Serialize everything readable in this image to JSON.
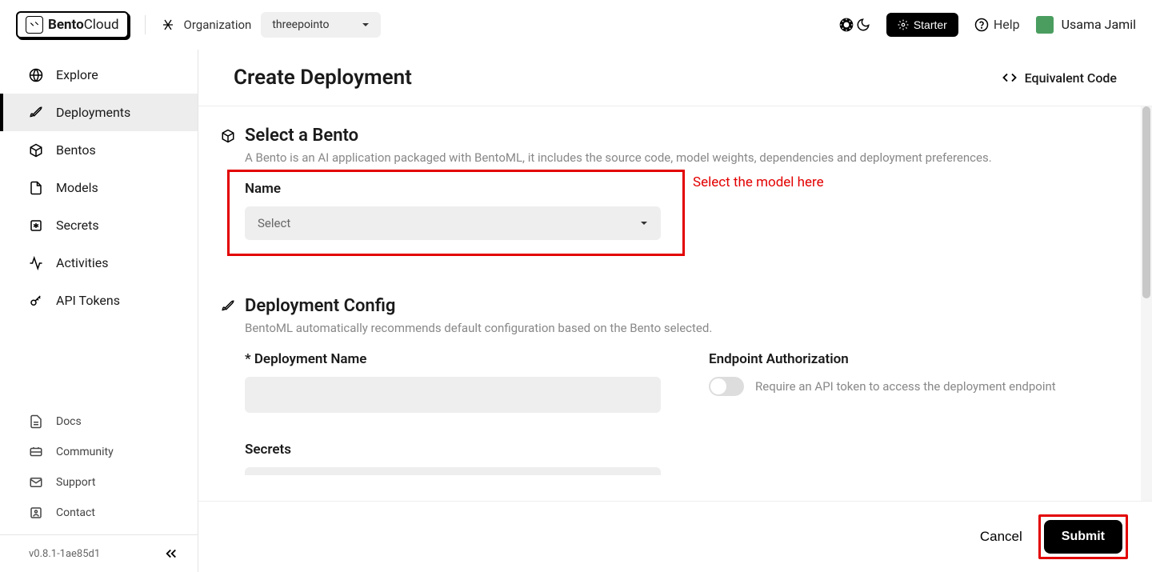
{
  "header": {
    "logo_bold": "Bento",
    "logo_thin": "Cloud",
    "org_label": "Organization",
    "org_value": "threepointo",
    "starter_label": "Starter",
    "help_label": "Help",
    "user_name": "Usama Jamil"
  },
  "sidebar": {
    "items": [
      {
        "label": "Explore",
        "icon": "world"
      },
      {
        "label": "Deployments",
        "icon": "rocket",
        "active": true
      },
      {
        "label": "Bentos",
        "icon": "box"
      },
      {
        "label": "Models",
        "icon": "file"
      },
      {
        "label": "Secrets",
        "icon": "asterisk"
      },
      {
        "label": "Activities",
        "icon": "activity"
      },
      {
        "label": "API Tokens",
        "icon": "key"
      }
    ],
    "bottom_items": [
      {
        "label": "Docs",
        "icon": "doc"
      },
      {
        "label": "Community",
        "icon": "community"
      },
      {
        "label": "Support",
        "icon": "support"
      },
      {
        "label": "Contact",
        "icon": "contact"
      }
    ],
    "version": "v0.8.1-1ae85d1"
  },
  "main": {
    "title": "Create Deployment",
    "equiv_code": "Equivalent Code",
    "section_bento": {
      "title": "Select a Bento",
      "desc": "A Bento is an AI application packaged with BentoML, it includes the source code, model weights, dependencies and deployment preferences.",
      "name_label": "Name",
      "name_placeholder": "Select"
    },
    "annotation_select": "Select the model here",
    "section_config": {
      "title": "Deployment Config",
      "desc": "BentoML automatically recommends default configuration based on the Bento selected.",
      "deploy_name_label": "Deployment Name",
      "endpoint_auth_label": "Endpoint Authorization",
      "endpoint_auth_desc": "Require an API token to access the deployment endpoint",
      "secrets_label": "Secrets"
    },
    "footer": {
      "cancel": "Cancel",
      "submit": "Submit"
    }
  }
}
